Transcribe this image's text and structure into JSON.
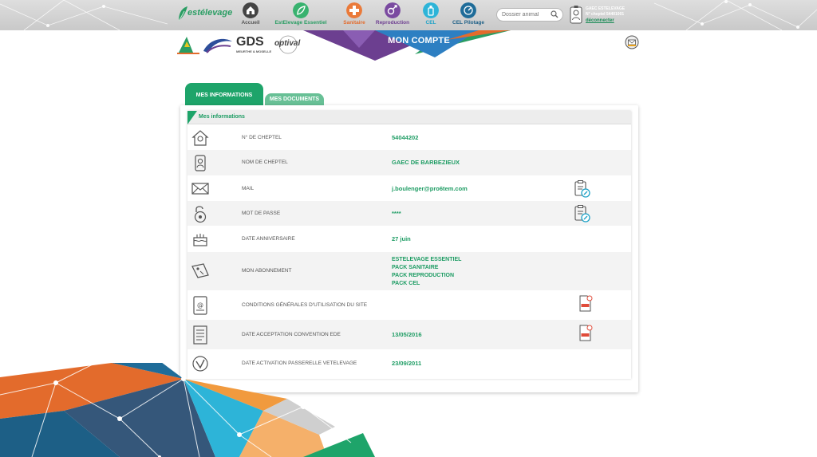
{
  "app": {
    "logo_text": "estélevage",
    "colors": {
      "accent": "#1d9c63",
      "tab_inactive": "#68c096"
    }
  },
  "nav": [
    {
      "label": "Accueil",
      "color": "#555555",
      "icon": "house-icon",
      "bg": "#444444"
    },
    {
      "label": "EstElevage Essentiel",
      "color": "#2a9d63",
      "icon": "leaf-icon",
      "bg": "#38b26f"
    },
    {
      "label": "Sanitaire",
      "color": "#e36b2c",
      "icon": "medical-cross-icon",
      "bg": "#ea7a3a"
    },
    {
      "label": "Reproduction",
      "color": "#6e3f91",
      "icon": "reproduction-icon",
      "bg": "#7a4aa0"
    },
    {
      "label": "CEL",
      "color": "#1ea2c7",
      "icon": "bottle-icon",
      "bg": "#2db4d8"
    },
    {
      "label": "CEL Pilotage",
      "color": "#1d5f86",
      "icon": "dashboard-icon",
      "bg": "#1f6c99"
    }
  ],
  "search": {
    "placeholder": "Dossier animal"
  },
  "user": {
    "name": "GAEC ESTELEVAGE",
    "cheptel": "N° cheptel 54401001",
    "logout": "déconnecter"
  },
  "partners": {
    "gds": "GDS",
    "gds_sub": "MEURTHE & MOSELLE",
    "optival": "optival"
  },
  "banner": {
    "title": "MON COMPTE"
  },
  "tabs": {
    "active": "MES INFORMATIONS",
    "inactive": "MES DOCUMENTS"
  },
  "card": {
    "title": "Mes informations"
  },
  "rows": [
    {
      "label": "N° de cheptel",
      "value": "54044202",
      "icon": "farm-house-icon"
    },
    {
      "label": "Nom de cheptel",
      "value": "GAEC DE BARBEZIEUX",
      "icon": "id-badge-icon"
    },
    {
      "label": "Mail",
      "value": "j.boulenger@pro6tem.com",
      "icon": "envelope-icon",
      "action": "edit-clipboard-icon"
    },
    {
      "label": "Mot de passe",
      "value": "****",
      "icon": "padlock-icon",
      "action": "edit-clipboard-icon"
    },
    {
      "label": "Date anniversaire",
      "value": "27 juin",
      "icon": "cake-icon"
    },
    {
      "label": "Mon abonnement",
      "values": [
        "ESTELEVAGE ESSENTIEL",
        "PACK SANITAIRE",
        "PACK REPRODUCTION",
        "PACK CEL"
      ],
      "icon": "price-tag-icon"
    },
    {
      "label": "Conditions générales d'utilisation du site",
      "value": "",
      "icon": "document-at-icon",
      "action": "pdf-icon"
    },
    {
      "label": "Date acceptation convention EDE",
      "value": "13/05/2016",
      "icon": "document-lines-icon",
      "action": "pdf-icon"
    },
    {
      "label": "Date activation passerelle Vetelevage",
      "value": "23/09/2011",
      "icon": "vetelevage-icon"
    }
  ]
}
